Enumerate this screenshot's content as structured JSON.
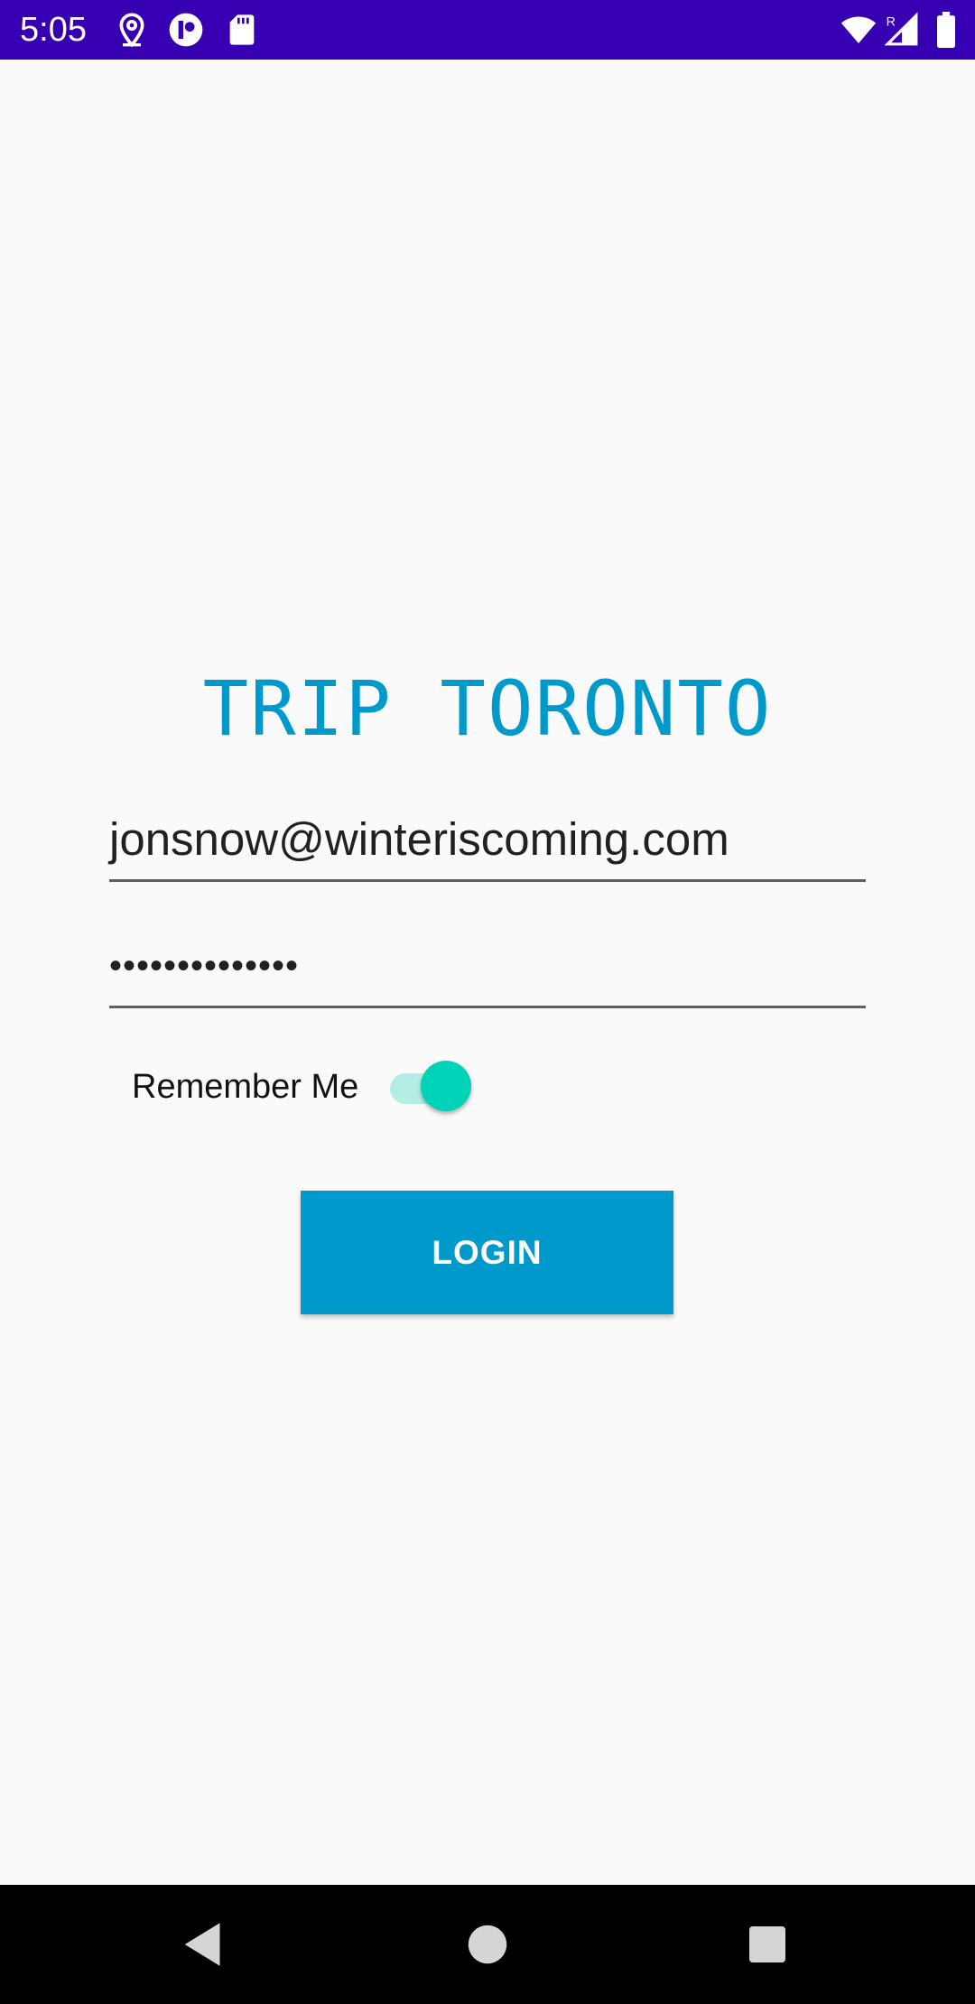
{
  "status_bar": {
    "time": "5:05",
    "icons": [
      "location-pin-icon",
      "app-notification-icon",
      "sd-card-icon",
      "wifi-icon",
      "signal-roaming-icon",
      "battery-icon"
    ],
    "roaming_indicator": "R",
    "background": "#3700b3"
  },
  "app": {
    "title": "TRIP TORONTO",
    "title_color": "#0099cc"
  },
  "login_form": {
    "email_value": "jonsnow@winteriscoming.com",
    "password_value": "••••••••••••••",
    "remember_label": "Remember Me",
    "remember_enabled": true,
    "switch_color": "#00d3b8",
    "login_label": "LOGIN",
    "button_color": "#0099cc"
  },
  "nav_bar": {
    "icons": [
      "back-icon",
      "home-icon",
      "recents-icon"
    ]
  }
}
